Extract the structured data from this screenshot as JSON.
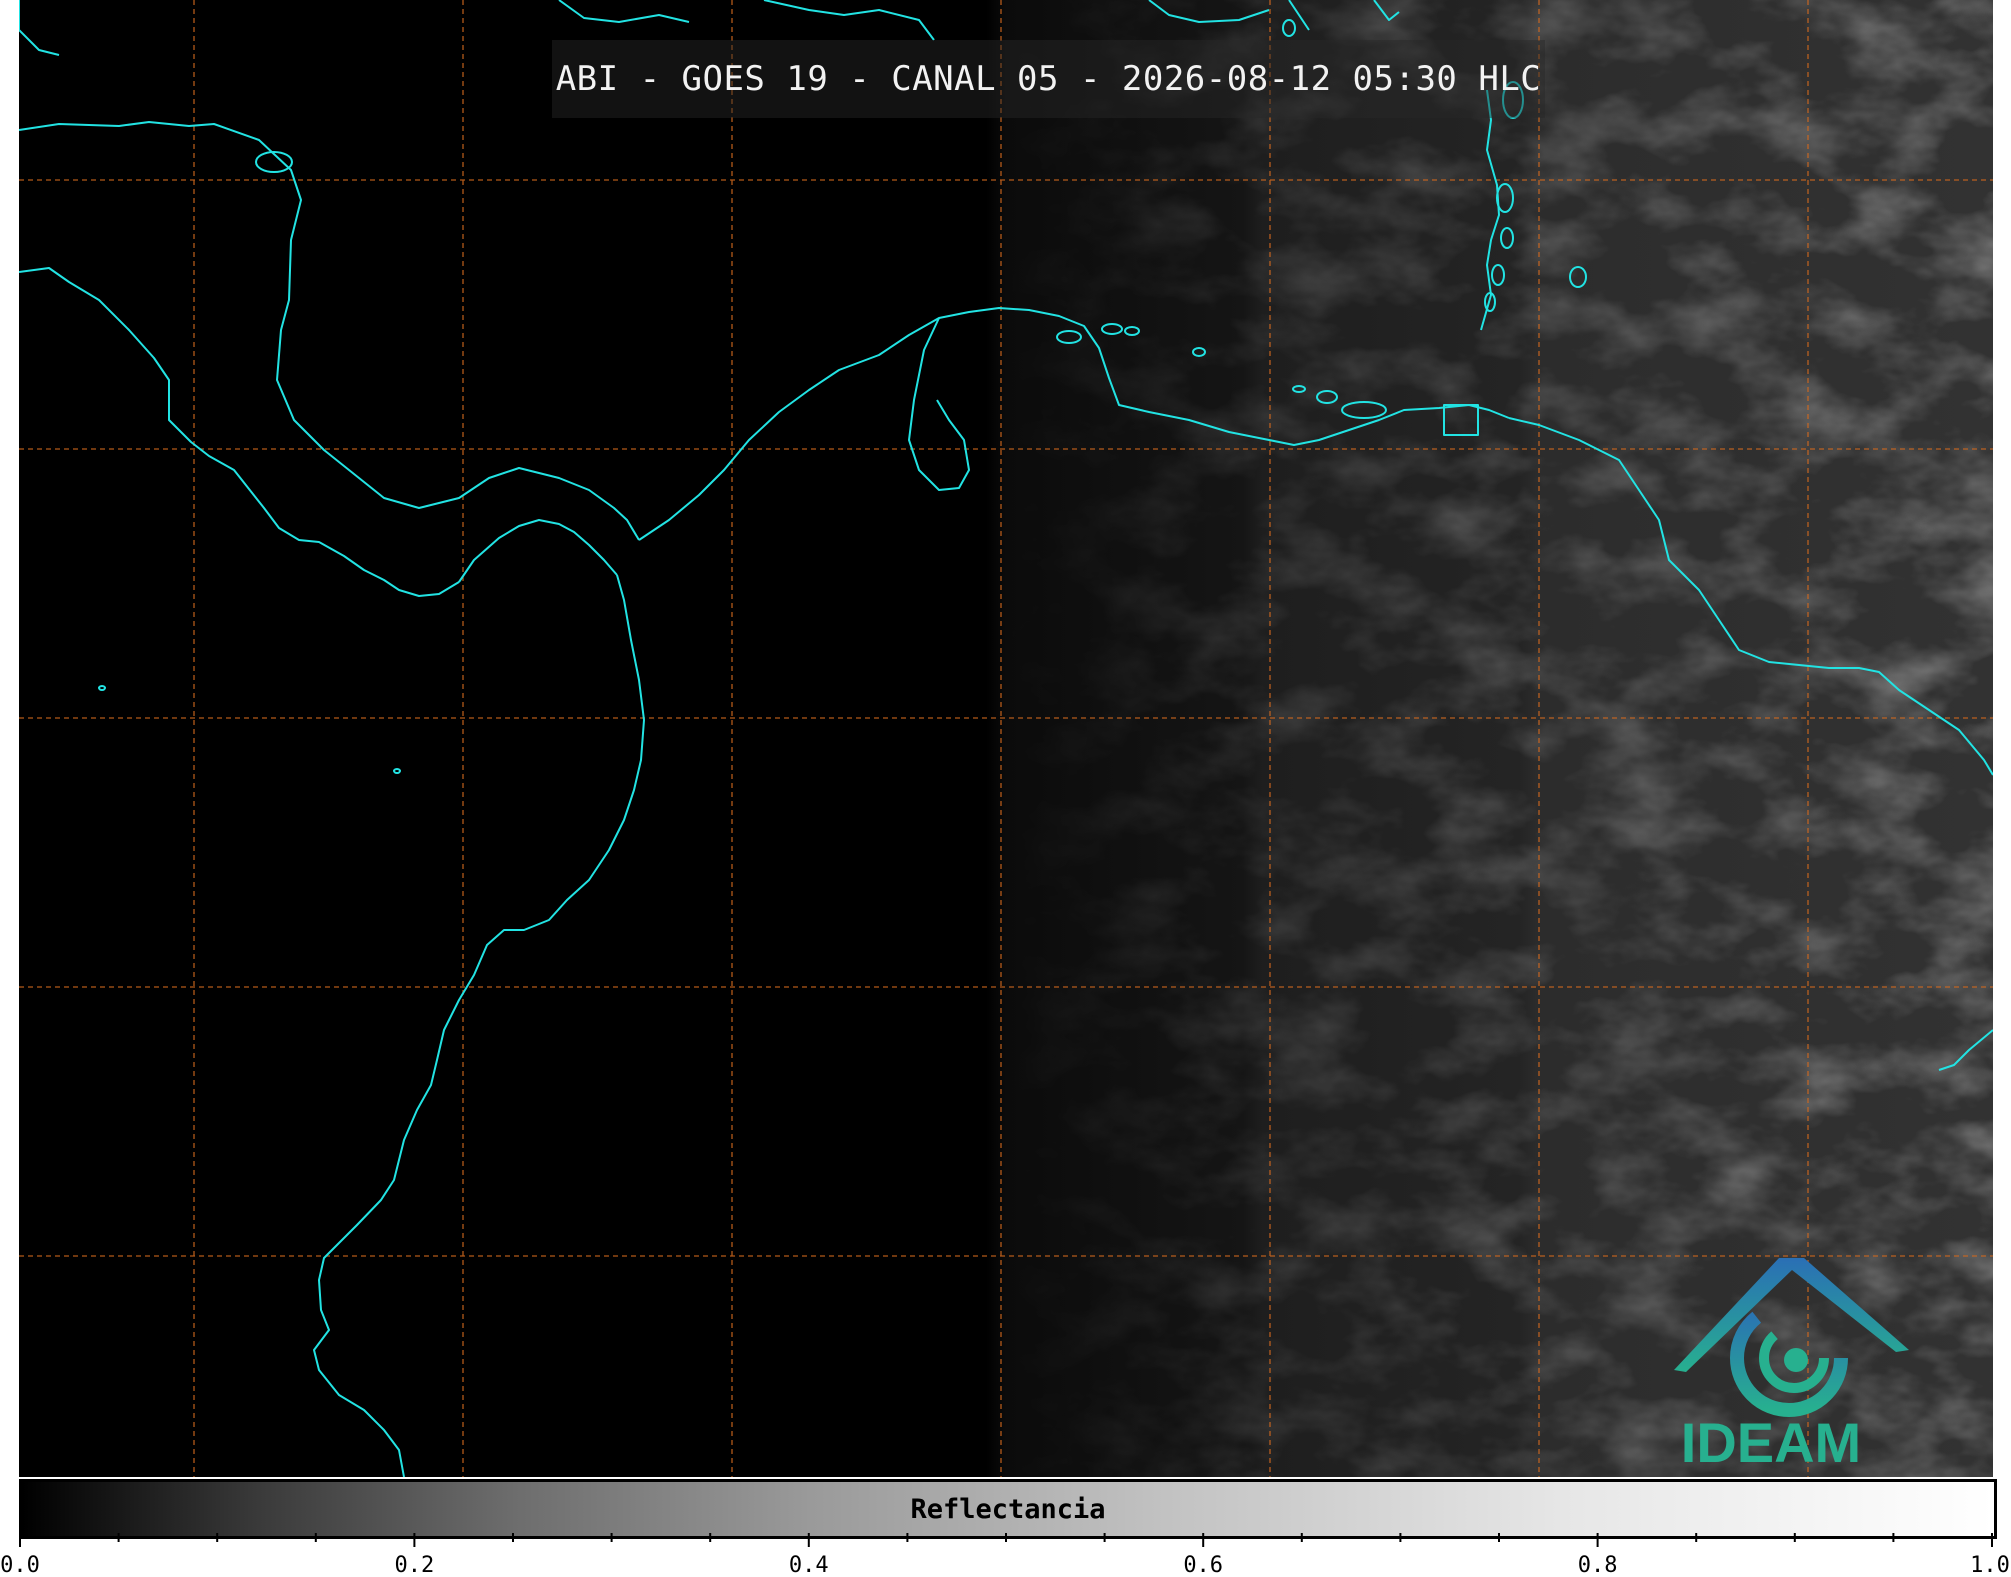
{
  "title": "ABI - GOES 19 - CANAL 05 - 2026-08-12 05:30 HLC",
  "logo": {
    "text": "IDEAM",
    "icon": "ideam-logo-icon",
    "color": "#27b08f",
    "accent": "#2a6fb5"
  },
  "colorbar": {
    "label": "Reflectancia",
    "range": [
      0.0,
      1.0
    ],
    "colormap": "grayscale",
    "tick_labels": [
      "0.0",
      "0.2",
      "0.4",
      "0.6",
      "0.8",
      "1.0"
    ],
    "tick_values": [
      0.0,
      0.2,
      0.4,
      0.6,
      0.8,
      1.0
    ],
    "minor_tick_step": 0.05
  },
  "map": {
    "coastline_color": "#22e3e3",
    "grid_color": "#d2691e",
    "grid_style": "dashed",
    "background": "#000000"
  }
}
